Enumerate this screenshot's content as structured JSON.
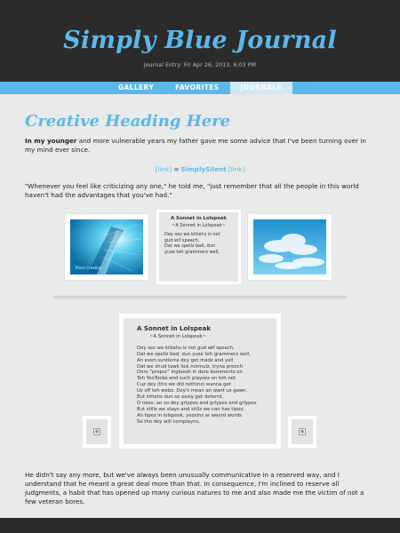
{
  "header": {
    "title": "Simply Blue Journal",
    "date_line": "Journal Entry: Fri Apr 26, 2013, 6:03 PM"
  },
  "nav": {
    "tabs": [
      {
        "label": "GALLERY"
      },
      {
        "label": "FAVORITES"
      },
      {
        "label": "JOURNALS"
      }
    ],
    "active": "JOURNALS"
  },
  "main": {
    "heading": "Creative Heading Here",
    "p1_bold": "In my younger",
    "p1_rest": " and more vulnerable years my father gave me some advice that I've been turning over in my mind ever since.",
    "links": {
      "left": "[link]",
      "eq": " = ",
      "middle": "SimplySilent",
      "right": " [link]"
    },
    "p2": "\"Whenever you feel like criticizing any one,\" he told me, \"just remember that all the people in this world haven't had the advantages that you've had.\"",
    "p3": "He didn't say any more, but we've always been unusually communicative in a reserved way, and I understand that he meant a great deal more than that. In consequence, I'm inclined to reserve all judgments, a habit that has opened up many curious natures to me and also made me the victim of not a few veteran bores."
  },
  "gallery": {
    "thumb1_caption": "Prism Creation",
    "small_poem": {
      "title": "A Sonnet in Lolspeak",
      "subtitle": "~A Sonnet in Lolspeak~",
      "lines": [
        "Dey sez we kittehs iz not",
        "gud wif speach,",
        "Dat we spellz bad, dun",
        "yuse teh grammerz well,"
      ]
    }
  },
  "big_poem": {
    "title": "A Sonnet in Lolspeak",
    "subtitle": "~A Sonnet in Lolspeak~",
    "lines": [
      "Dey sez we kittehs iz not gud wif speach,",
      "Dat we spellz bad, dun yuse teh grammerz well,",
      "An even suntlems dey get madz and yell",
      "Dat we shud tawk liek normulz, tryna preech",
      "Dere \"propur\" ingleesh in dere kommentz on",
      "Teh YooToobs and such playses on teh net",
      "Cuz dey (tho we did nothinz) wanna get",
      "Us off teh webz. Dey's mean an want us gawn.",
      "But kittehs dun so eesly get deterrd,",
      "O noes, an so dey grlypes and grlypes and grlypes",
      "But stillz we stays and stillz we can has tipez,",
      "An tipez in lolspeek, yoosinz ar weerd wurds.",
      "So tho dey will complayns,"
    ]
  },
  "colors": {
    "accent": "#5bb8e8",
    "header_bg": "#2b2b2b",
    "page_bg": "#e9eaea"
  }
}
